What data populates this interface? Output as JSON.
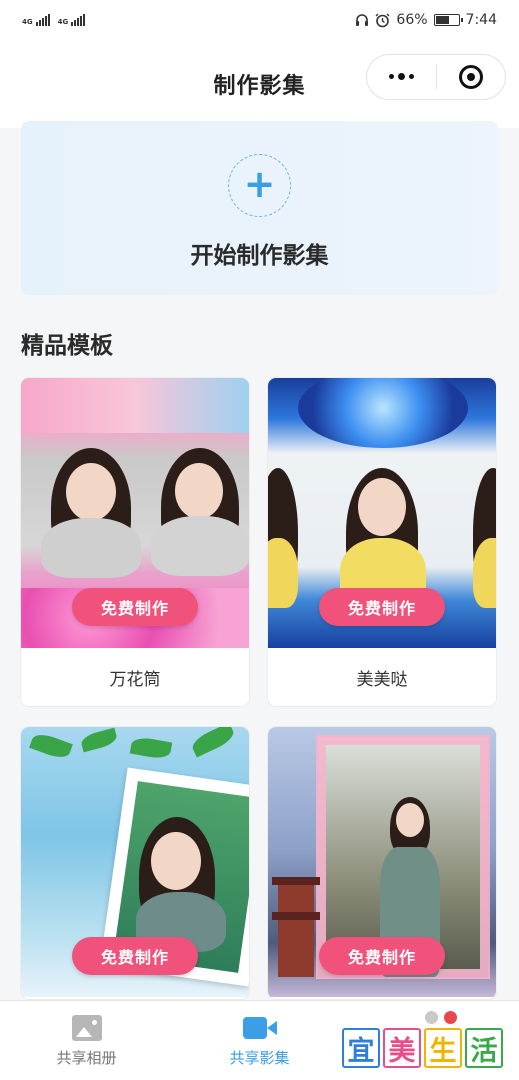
{
  "status_bar": {
    "network1": "4G",
    "network2": "4G",
    "battery": "66%",
    "battery_level": 0.66,
    "time": "7:44"
  },
  "header": {
    "title": "制作影集"
  },
  "create": {
    "label": "开始制作影集"
  },
  "section": {
    "title": "精品模板"
  },
  "templates": [
    {
      "name": "万花筒",
      "button": "免费制作"
    },
    {
      "name": "美美哒",
      "button": "免费制作"
    },
    {
      "name": "",
      "button": "免费制作"
    },
    {
      "name": "",
      "button": "免费制作"
    }
  ],
  "tabbar": {
    "items": [
      {
        "label": "共享相册",
        "icon": "photo-album-icon",
        "active": false
      },
      {
        "label": "共享影集",
        "icon": "video-camera-icon",
        "active": true
      }
    ]
  },
  "watermark": {
    "chars": [
      "宜",
      "美",
      "生",
      "活"
    ],
    "colors": [
      "#2f7fd8",
      "#e94d8c",
      "#f3b400",
      "#39a94a"
    ]
  },
  "colors": {
    "accent": "#3b9fe6",
    "button": "#f0527c"
  }
}
